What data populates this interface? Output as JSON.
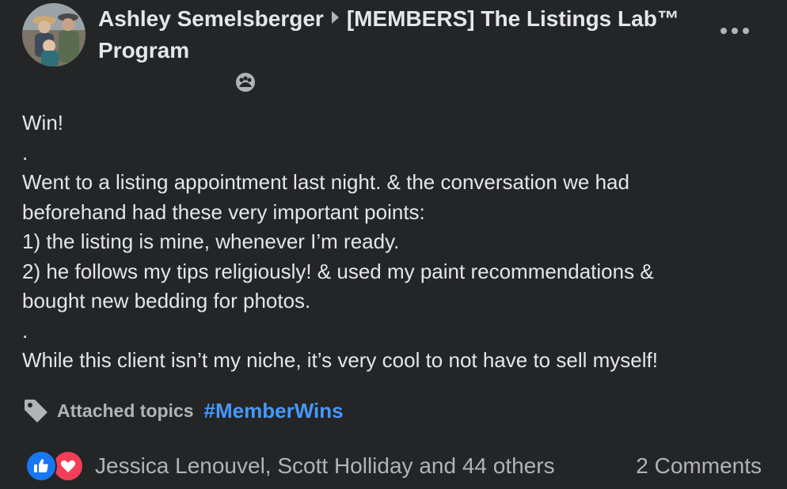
{
  "header": {
    "author": "Ashley Semelsberger",
    "group": "[MEMBERS] The Listings Lab™ Program",
    "more_icon": "more-horizontal-icon",
    "privacy_icon": "members-privacy-icon"
  },
  "post": {
    "lines": [
      "Win!",
      ".",
      "Went to a listing appointment last night. & the conversation we had",
      "beforehand had these very important points:",
      "1) the listing is mine, whenever I’m ready.",
      "2) he follows my tips religiously! & used my paint recommendations &",
      "bought new bedding for photos.",
      ".",
      "While this client isn’t my niche, it’s very cool to not have to sell myself!"
    ]
  },
  "topics": {
    "label": "Attached topics",
    "tag": "#MemberWins",
    "icon": "tag-icon"
  },
  "reactions": {
    "names": "Jessica Lenouvel, Scott Holliday and 44 others",
    "comments": "2 Comments",
    "icons": [
      "like-icon",
      "love-icon"
    ]
  },
  "colors": {
    "background": "#242526",
    "text": "#e4e6eb",
    "secondary": "#b0b3b8",
    "link": "#4599ff",
    "like": "#1877f2",
    "love": "#f33e58"
  }
}
